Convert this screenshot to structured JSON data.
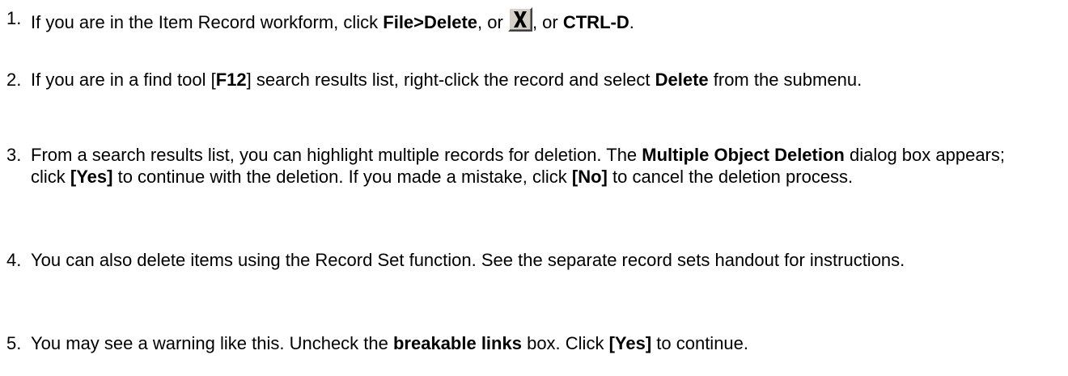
{
  "steps": [
    {
      "number": "1.",
      "t1": "If you are in the Item Record workform, click ",
      "b1": "File>Delete",
      "t2": ", or ",
      "icon": "delete-x-icon",
      "t3": ", or ",
      "b2": "CTRL-D",
      "t4": "."
    },
    {
      "number": "2.",
      "t1": "If you are in a find tool [",
      "b1": "F12",
      "t2": "] search results list, right-click the record and select ",
      "b2": "Delete",
      "t3": " from the submenu."
    },
    {
      "number": "3.",
      "t1": "From a search results list, you can highlight multiple records for deletion.  The ",
      "b1": "Multiple Object Deletion",
      "t2": " dialog box appears; click ",
      "b2": "[Yes]",
      "t3": " to continue with the deletion.  If you made a mistake, click ",
      "b3": "[No]",
      "t4": " to cancel the deletion process."
    },
    {
      "number": "4.",
      "t1": "You can also delete items using the Record Set function.  See the separate record sets handout for instructions."
    },
    {
      "number": "5.",
      "t1": "You may see a warning like this.  Uncheck the ",
      "b1": "breakable links",
      "t2": " box. Click ",
      "b2": "[Yes]",
      "t3": " to continue."
    }
  ]
}
